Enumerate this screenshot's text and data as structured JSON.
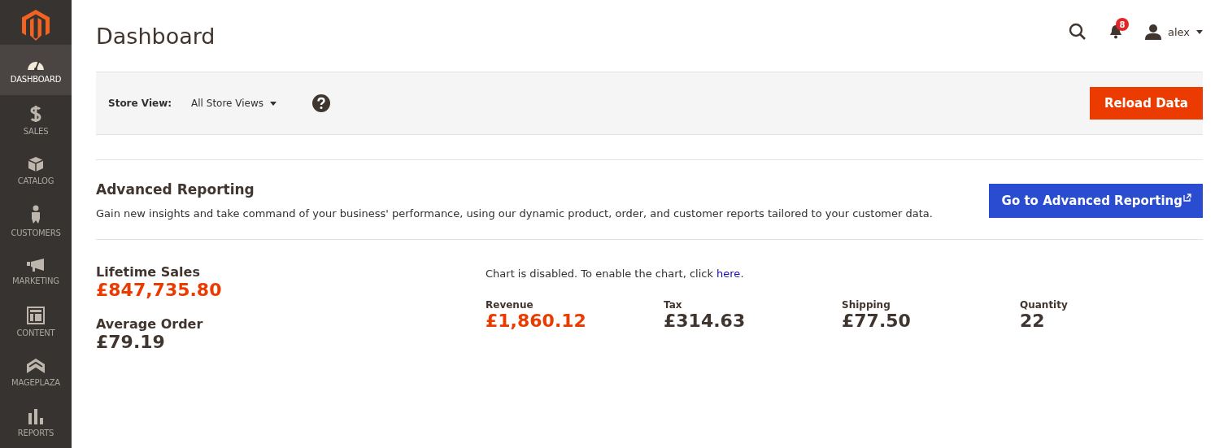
{
  "sidebar": {
    "items": [
      {
        "label": "DASHBOARD",
        "selected": true
      },
      {
        "label": "SALES",
        "selected": false
      },
      {
        "label": "CATALOG",
        "selected": false
      },
      {
        "label": "CUSTOMERS",
        "selected": false
      },
      {
        "label": "MARKETING",
        "selected": false
      },
      {
        "label": "CONTENT",
        "selected": false
      },
      {
        "label": "MAGEPLAZA",
        "selected": false
      },
      {
        "label": "REPORTS",
        "selected": false
      }
    ]
  },
  "header": {
    "title": "Dashboard",
    "notification_count": "8",
    "user": "alex"
  },
  "store_bar": {
    "label": "Store View:",
    "value": "All Store Views",
    "button": "Reload Data"
  },
  "advanced_reporting": {
    "title": "Advanced Reporting",
    "description": "Gain new insights and take command of your business' performance, using our dynamic product, order, and customer reports tailored to your customer data.",
    "button": "Go to Advanced Reporting"
  },
  "summary": [
    {
      "label": "Lifetime Sales",
      "value": "£847,735.80",
      "highlighted": true
    },
    {
      "label": "Average Order",
      "value": "£79.19",
      "highlighted": false
    }
  ],
  "chart_note": {
    "text": "Chart is disabled. To enable the chart, click ",
    "link": "here",
    "after": "."
  },
  "totals": [
    {
      "label": "Revenue",
      "value": "£1,860.12",
      "highlighted": true
    },
    {
      "label": "Tax",
      "value": "£314.63",
      "highlighted": false
    },
    {
      "label": "Shipping",
      "value": "£77.50",
      "highlighted": false
    },
    {
      "label": "Quantity",
      "value": "22",
      "highlighted": false
    }
  ]
}
